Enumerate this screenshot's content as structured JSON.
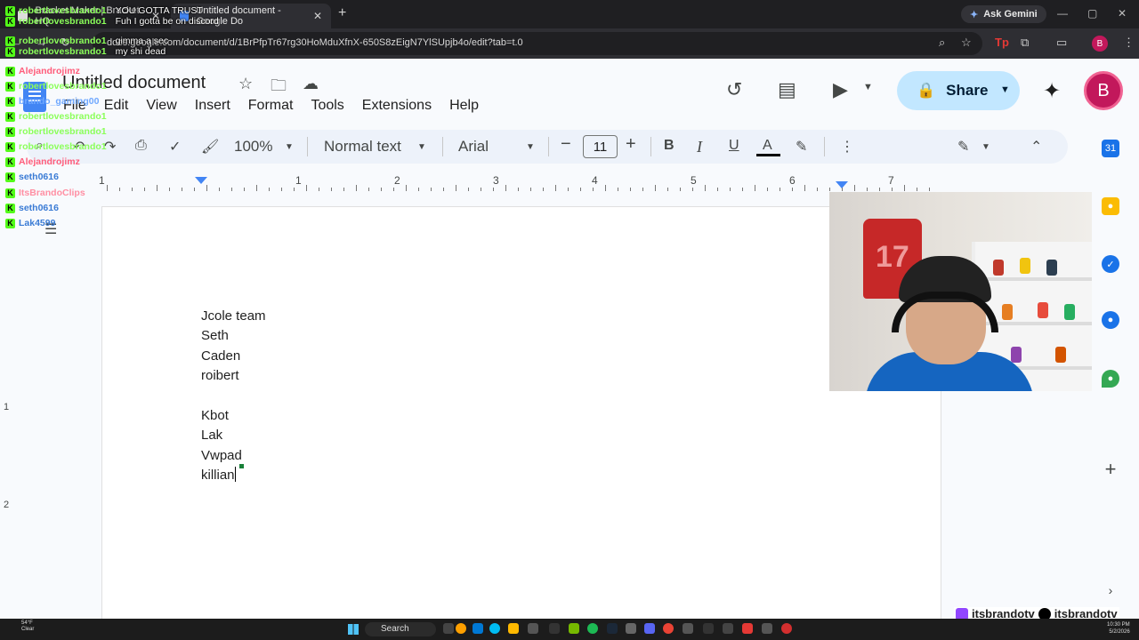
{
  "browser": {
    "tabs": [
      {
        "label": "Bracket Maker | Bracket HQ",
        "active": false
      },
      {
        "label": "Untitled document - Google Do",
        "active": true
      }
    ],
    "url": "docs.google.com/document/d/1BrPfpTr67rg30HoMduXfnX-650S8zEigN7YlSUpjb4o/edit?tab=t.0",
    "ask_gemini": "Ask Gemini",
    "profile_initial": "B"
  },
  "docs": {
    "title": "Untitled document",
    "menu": [
      "File",
      "Edit",
      "View",
      "Insert",
      "Format",
      "Tools",
      "Extensions",
      "Help"
    ],
    "share_label": "Share",
    "account_initial": "B",
    "toolbar": {
      "zoom": "100%",
      "style": "Normal text",
      "font": "Arial",
      "font_size": "11",
      "bold": "B",
      "italic": "I",
      "underline": "U",
      "text_color": "A"
    },
    "ruler_numbers": [
      "1",
      "1",
      "2",
      "3",
      "4",
      "5",
      "6",
      "7"
    ],
    "vertical_ruler_numbers": [
      "1",
      "2"
    ],
    "body_lines": [
      "Jcole team",
      "Seth",
      "Caden",
      "roibert",
      "",
      "Kbot",
      "Lak",
      "Vwpad",
      "killian"
    ]
  },
  "chat": {
    "messages": [
      {
        "user": "robertlovesbrando1",
        "text": "YOU GOTTA TRUST",
        "color": "#8bff5a"
      },
      {
        "user": "robertlovesbrando1",
        "text": "Fuh I gotta be on discord",
        "color": "#8bff5a"
      },
      {
        "user": "robertlovesbrando1",
        "text": "gimma a sec",
        "color": "#8bff5a"
      },
      {
        "user": "robertlovesbrando1",
        "text": "my shi dead",
        "color": "#8bff5a"
      },
      {
        "user": "Alejandrojimz",
        "text": "",
        "color": "#ff5c7a"
      },
      {
        "user": "robertlovesbrando1",
        "text": "",
        "color": "#8bff5a"
      },
      {
        "user": "brando_gaming00",
        "text": "",
        "color": "#6fa8ff"
      },
      {
        "user": "robertlovesbrando1",
        "text": "",
        "color": "#8bff5a"
      },
      {
        "user": "robertlovesbrando1",
        "text": "",
        "color": "#8bff5a"
      },
      {
        "user": "robertlovesbrando1",
        "text": "",
        "color": "#8bff5a"
      },
      {
        "user": "Alejandrojimz",
        "text": "",
        "color": "#ff5c7a"
      },
      {
        "user": "seth0616",
        "text": "",
        "color": "#3a7bd5"
      },
      {
        "user": "ItsBrandoClips",
        "text": "",
        "color": "#ff8fa3"
      },
      {
        "user": "seth0616",
        "text": "",
        "color": "#3a7bd5"
      },
      {
        "user": "Lak4599",
        "text": "",
        "color": "#3a7bd5"
      }
    ]
  },
  "taskbar": {
    "weather": [
      "54°F",
      "Clear"
    ],
    "search_label": "Search",
    "time": "10:30 PM",
    "date": "5/2/2026"
  },
  "stream": {
    "handle": "itsbrandotv",
    "handle2": "itsbrandotv"
  },
  "colors": {
    "kick_green": "#53fc18",
    "share_bg": "#c2e7ff",
    "docs_blue": "#4285f4"
  }
}
